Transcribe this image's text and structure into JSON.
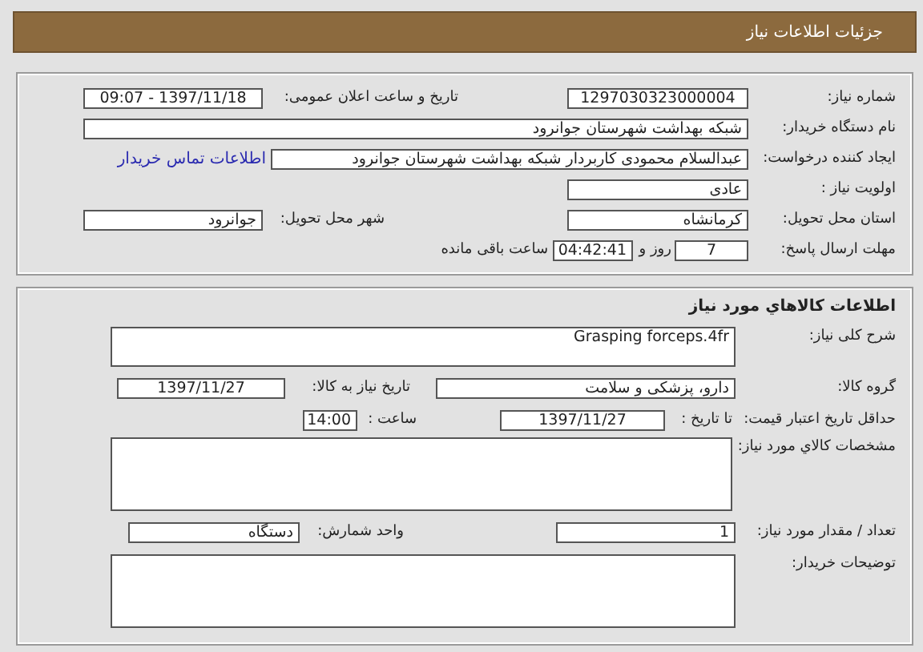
{
  "header": {
    "title": "جزئیات اطلاعات نیاز"
  },
  "sections": [
    {
      "rows": [
        {
          "items": [
            {
              "kind": "label",
              "text": "شماره نیاز:"
            },
            {
              "kind": "field",
              "value": "1297030323000004"
            },
            {
              "kind": "label",
              "text": "تاریخ و ساعت اعلان عمومی:"
            },
            {
              "kind": "field",
              "value": "1397/11/18 - 09:07"
            }
          ]
        },
        {
          "items": [
            {
              "kind": "label",
              "text": "نام دستگاه خریدار:"
            },
            {
              "kind": "field",
              "value": "شبکه بهداشت شهرستان جوانرود"
            }
          ]
        },
        {
          "items": [
            {
              "kind": "label",
              "text": "ایجاد کننده درخواست:"
            },
            {
              "kind": "field",
              "value": "عبدالسلام محمودی کاربردار شبکه بهداشت شهرستان جوانرود"
            },
            {
              "kind": "link",
              "text": "اطلاعات تماس خریدار"
            }
          ]
        },
        {
          "items": [
            {
              "kind": "label",
              "text": "اولویت نیاز :"
            },
            {
              "kind": "field",
              "value": "عادی"
            }
          ]
        },
        {
          "items": [
            {
              "kind": "label",
              "text": "استان محل تحویل:"
            },
            {
              "kind": "field",
              "value": "کرمانشاه"
            },
            {
              "kind": "label",
              "text": "شهر محل تحویل:"
            },
            {
              "kind": "field",
              "value": "جوانرود"
            }
          ]
        },
        {
          "items": [
            {
              "kind": "label",
              "text": "مهلت ارسال پاسخ:"
            },
            {
              "kind": "field",
              "value": "7"
            },
            {
              "kind": "label",
              "text": "روز و"
            },
            {
              "kind": "field",
              "value": "04:42:41"
            },
            {
              "kind": "label",
              "text": "ساعت باقی مانده"
            }
          ]
        }
      ]
    },
    {
      "title": "اطلاعات کالاهاي مورد نياز",
      "rows": [
        {
          "items": [
            {
              "kind": "label",
              "text": "شرح کلی نیاز:"
            },
            {
              "kind": "textarea",
              "value": "Grasping forceps.4fr"
            }
          ]
        },
        {
          "items": [
            {
              "kind": "label",
              "text": "گروه کالا:"
            },
            {
              "kind": "field",
              "value": "دارو، پزشکی و سلامت"
            },
            {
              "kind": "label",
              "text": "تاریخ نیاز به کالا:"
            },
            {
              "kind": "field",
              "value": "1397/11/27"
            }
          ]
        },
        {
          "items": [
            {
              "kind": "label",
              "text": "حداقل تاریخ اعتبار قیمت:"
            },
            {
              "kind": "label",
              "text": "تا تاریخ :"
            },
            {
              "kind": "field",
              "value": "1397/11/27"
            },
            {
              "kind": "label",
              "text": "ساعت :"
            },
            {
              "kind": "field",
              "value": "14:00"
            }
          ]
        },
        {
          "items": [
            {
              "kind": "label",
              "text": "مشخصات کالاي مورد نياز:"
            },
            {
              "kind": "textarea"
            }
          ]
        },
        {
          "items": [
            {
              "kind": "label",
              "text": "تعداد / مقدار مورد نیاز:"
            },
            {
              "kind": "field",
              "value": "1"
            },
            {
              "kind": "label",
              "text": "واحد شمارش:"
            },
            {
              "kind": "field",
              "value": "دستگاه"
            }
          ]
        },
        {
          "items": [
            {
              "kind": "label",
              "text": "توضیحات خریدار:"
            },
            {
              "kind": "textarea"
            }
          ]
        }
      ]
    }
  ]
}
